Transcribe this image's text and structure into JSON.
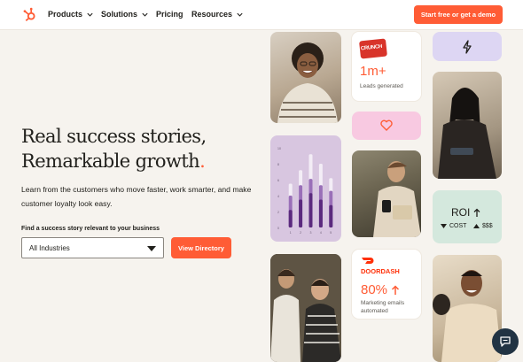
{
  "nav": {
    "items": [
      {
        "label": "Products",
        "dropdown": true
      },
      {
        "label": "Solutions",
        "dropdown": true
      },
      {
        "label": "Pricing",
        "dropdown": false
      },
      {
        "label": "Resources",
        "dropdown": true
      }
    ],
    "cta_label": "Start free or get a demo"
  },
  "hero": {
    "title_line1": "Real success stories,",
    "title_line2": "Remarkable growth",
    "title_period": ".",
    "subtitle": "Learn from the customers who move faster, work smarter, and make customer loyalty look easy.",
    "find_label": "Find a success story relevant to your business",
    "select_value": "All Industries",
    "view_button": "View Directory"
  },
  "cards": {
    "crunch": {
      "logo_text": "CRUNCH",
      "stat": "1m+",
      "caption": "Leads generated"
    },
    "roi": {
      "title": "ROI",
      "cost_label": "COST",
      "revenue_label": "$$$"
    },
    "doordash": {
      "logo_text": "DOORDASH",
      "stat": "80%",
      "caption": "Marketing emails automated"
    },
    "chart": {
      "tick_labels": [
        "10",
        "8",
        "6",
        "4",
        "2",
        "0"
      ],
      "x_labels": [
        "1",
        "2",
        "3",
        "4",
        "5"
      ]
    }
  },
  "colors": {
    "accent": "#ff5c35",
    "lavender": "#ddd6f3",
    "pink": "#f8c9e1",
    "mint": "#d4e8dd",
    "chart_bg": "#d8c6e0"
  }
}
